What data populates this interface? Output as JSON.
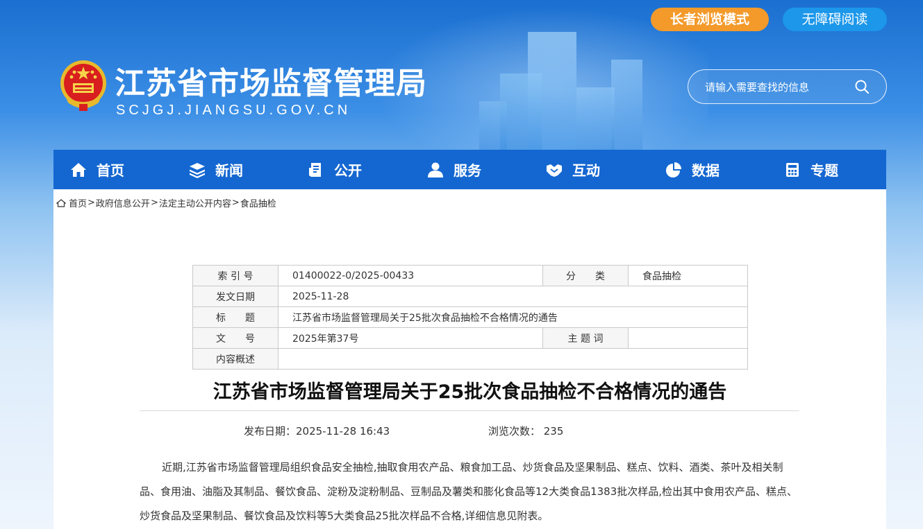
{
  "header": {
    "elder_mode_label": "长者浏览模式",
    "accessible_label": "无障碍阅读",
    "site_title": "江苏省市场监督管理局",
    "site_domain": "SCJGJ.JIANGSU.GOV.CN",
    "search_placeholder": "请输入需要查找的信息"
  },
  "nav": {
    "items": [
      {
        "label": "首页",
        "icon": "home-icon"
      },
      {
        "label": "新闻",
        "icon": "layers-icon"
      },
      {
        "label": "公开",
        "icon": "document-icon"
      },
      {
        "label": "服务",
        "icon": "user-icon"
      },
      {
        "label": "互动",
        "icon": "handshake-icon"
      },
      {
        "label": "数据",
        "icon": "pie-chart-icon"
      },
      {
        "label": "专题",
        "icon": "calculator-icon"
      }
    ]
  },
  "breadcrumb": [
    "首页",
    "政府信息公开",
    "法定主动公开内容",
    "食品抽检"
  ],
  "meta": {
    "index_label": "索 引 号",
    "index_value": "01400022-0/2025-00433",
    "category_label": "分　　类",
    "category_value": "食品抽检",
    "date_label": "发文日期",
    "date_value": "2025-11-28",
    "title_label": "标　　题",
    "title_value": "江苏省市场监督管理局关于25批次食品抽检不合格情况的通告",
    "docno_label": "文　　号",
    "docno_value": "2025年第37号",
    "keyword_label": "主 题 词",
    "keyword_value": "",
    "summary_label": "内容概述",
    "summary_value": ""
  },
  "article": {
    "title": "江苏省市场监督管理局关于25批次食品抽检不合格情况的通告",
    "publish": "发布日期：2025-11-28 16:43",
    "views": "浏览次数： 235",
    "paragraph": "近期,江苏省市场监督管理局组织食品安全抽检,抽取食用农产品、粮食加工品、炒货食品及坚果制品、糕点、饮料、酒类、茶叶及相关制品、食用油、油脂及其制品、餐饮食品、淀粉及淀粉制品、豆制品及薯类和膨化食品等12大类食品1383批次样品,检出其中食用农产品、糕点、炒货食品及坚果制品、餐饮食品及饮料等5大类食品25批次样品不合格,详细信息见附表。"
  }
}
